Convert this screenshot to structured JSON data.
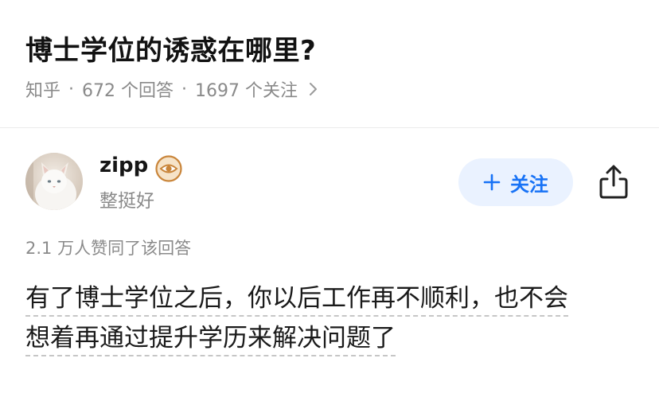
{
  "question": {
    "title": "博士学位的诱惑在哪里?",
    "source": "知乎",
    "answers_count": "672 个回答",
    "followers_count": "1697 个关注"
  },
  "author": {
    "name": "zipp",
    "bio": "整挺好",
    "badge_icon": "eye-badge-icon",
    "avatar": "cat-avatar"
  },
  "actions": {
    "follow_label": "关注",
    "share_icon": "share-icon"
  },
  "answer": {
    "votes": "2.1 万人赞同了该回答",
    "line1": "有了博士学位之后，你以后工作再不顺利，也不会",
    "line2": "想着再通过提升学历来解决问题了"
  },
  "colors": {
    "accent": "#1772f6",
    "follow_bg": "#eaf2ff",
    "muted": "#8a8a8a",
    "badge": "#c9853a"
  }
}
